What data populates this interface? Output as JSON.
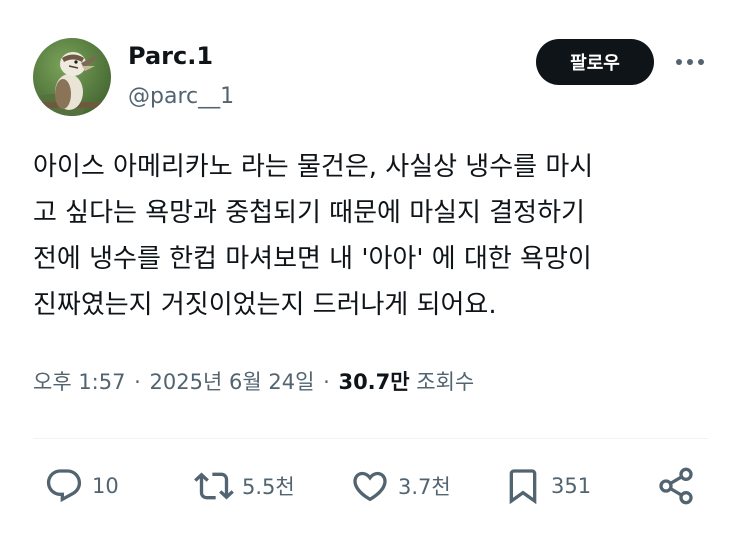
{
  "author": {
    "name": "Parc.1",
    "handle": "@parc__1"
  },
  "follow_label": "팔로우",
  "tweet": {
    "lines": [
      "아이스 아메리카노 라는 물건은, 사실상 냉수를 마시",
      "고 싶다는 욕망과 중첩되기 때문에 마실지 결정하기",
      "전에 냉수를 한컵 마셔보면 내 '아아' 에 대한 욕망이",
      "진짜였는지 거짓이었는지 드러나게 되어요."
    ]
  },
  "meta": {
    "time": "오후 1:57",
    "separator": "·",
    "date": "2025년 6월 24일",
    "views_count": "30.7만",
    "views_label": "조회수"
  },
  "actions": {
    "replies": "10",
    "reposts": "5.5천",
    "likes": "3.7천",
    "bookmarks": "351"
  },
  "icons": {
    "avatar": "kookaburra-bird-avatar",
    "more": "more-horizontal-icon",
    "reply": "reply-icon",
    "repost": "repost-icon",
    "like": "heart-icon",
    "bookmark": "bookmark-icon",
    "share": "share-icon"
  },
  "colors": {
    "text": "#0f1419",
    "secondary": "#536471",
    "button": "#0f1419",
    "divider": "#eff3f4"
  }
}
